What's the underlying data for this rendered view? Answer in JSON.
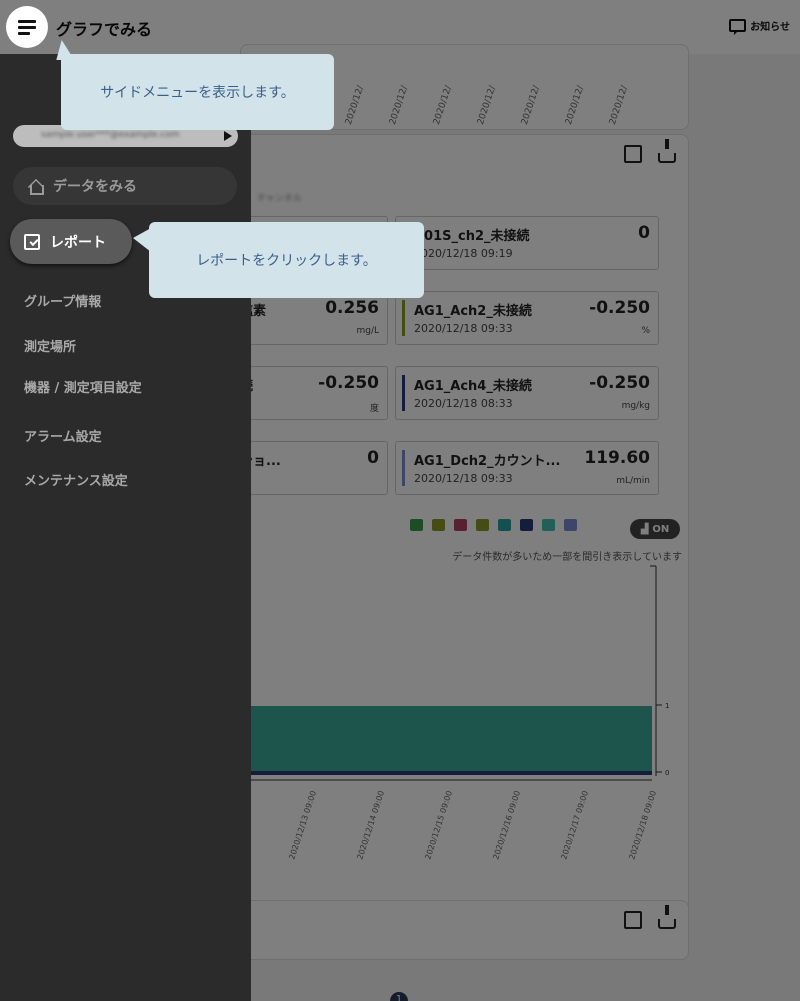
{
  "header": {
    "title": "グラフでみる",
    "notice_label": "お知らせ"
  },
  "top_chart": {
    "date_labels": [
      "2020/12/",
      "2020/12/",
      "2020/12/",
      "2020/12/",
      "2020/12/",
      "2020/12/",
      "2020/12/"
    ]
  },
  "sensors": {
    "right": [
      {
        "name": "A01S_ch2_未接続",
        "time": "2020/12/18 09:19",
        "value": "0",
        "unit": "",
        "color": ""
      },
      {
        "name": "AG1_Ach2_未接続",
        "time": "2020/12/18 09:33",
        "value": "-0.250",
        "unit": "%",
        "color": "#8a9a2a"
      },
      {
        "name": "AG1_Ach4_未接続",
        "time": "2020/12/18 08:33",
        "value": "-0.250",
        "unit": "mg/kg",
        "color": "#2a3a7a"
      },
      {
        "name": "AG1_Dch2_カウント...",
        "time": "2020/12/18 09:33",
        "value": "119.60",
        "unit": "mL/min",
        "color": "#7a8ad0"
      }
    ],
    "left": [
      {
        "name": "",
        "value": "",
        "unit": ""
      },
      {
        "name": "塩素",
        "value": "0.256",
        "unit": "mg/L"
      },
      {
        "name": "続",
        "value": "-0.250",
        "unit": "度"
      },
      {
        "name": "ショ...",
        "value": "0",
        "unit": ""
      }
    ]
  },
  "chart": {
    "legend_colors": [
      "#3a9a4a",
      "#8a9a2a",
      "#b04060",
      "#8a9a2a",
      "#2aa0a0",
      "#2a3a7a",
      "#40c0b0",
      "#7a8ad0"
    ],
    "toggle_label": "ON",
    "sampling_note": "データ件数が多いため一部を間引き表示しています",
    "y_ticks": [
      "1",
      "0"
    ],
    "x_labels": [
      "2020/12/13 09:00",
      "2020/12/14 09:00",
      "2020/12/15 09:00",
      "2020/12/16 09:00",
      "2020/12/17 09:00",
      "2020/12/18 09:00"
    ]
  },
  "pagination": {
    "current": "1"
  },
  "sidemenu": {
    "account_text": "sample.user***@example.com",
    "nav_data": "データをみる",
    "nav_report": "レポート",
    "items": [
      "グループ情報",
      "測定場所",
      "機器 / 測定項目設定",
      "アラーム設定",
      "メンテナンス設定"
    ]
  },
  "tooltips": {
    "side_menu": "サイドメニューを表示します。",
    "report": "レポートをクリックします。"
  }
}
